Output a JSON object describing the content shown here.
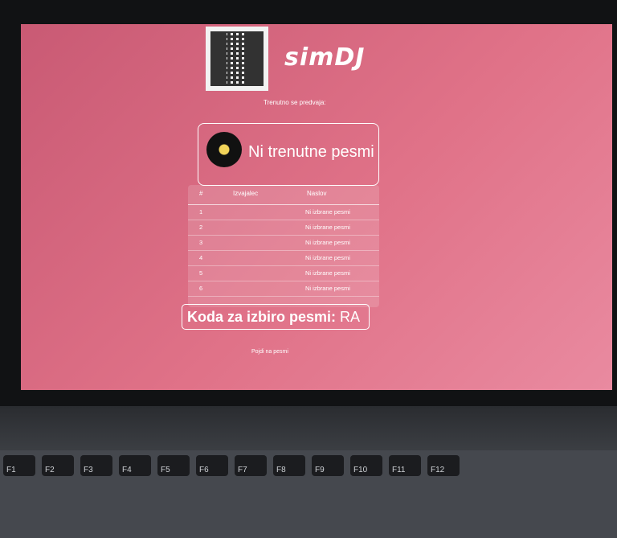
{
  "app": {
    "brand": "simDJ"
  },
  "now_playing": {
    "label": "Trenutno se predvaja:",
    "title": "Ni trenutne pesmi"
  },
  "queue": {
    "headers": [
      "#",
      "Izvajalec",
      "Naslov"
    ],
    "rows": [
      {
        "n": "1",
        "artist": "",
        "title": "Ni izbrane pesmi"
      },
      {
        "n": "2",
        "artist": "",
        "title": "Ni izbrane pesmi"
      },
      {
        "n": "3",
        "artist": "",
        "title": "Ni izbrane pesmi"
      },
      {
        "n": "4",
        "artist": "",
        "title": "Ni izbrane pesmi"
      },
      {
        "n": "5",
        "artist": "",
        "title": "Ni izbrane pesmi"
      },
      {
        "n": "6",
        "artist": "",
        "title": "Ni izbrane pesmi"
      }
    ]
  },
  "code": {
    "label": "Koda za izbiro pesmi:",
    "value": "RA"
  },
  "link": {
    "label": "Pojdi na pesmi"
  },
  "keyboard": {
    "row1": [
      "F1",
      "F2",
      "F3",
      "F4",
      "F5",
      "F6",
      "F7",
      "F8",
      "F9",
      "F10",
      "F11",
      "F12"
    ]
  }
}
